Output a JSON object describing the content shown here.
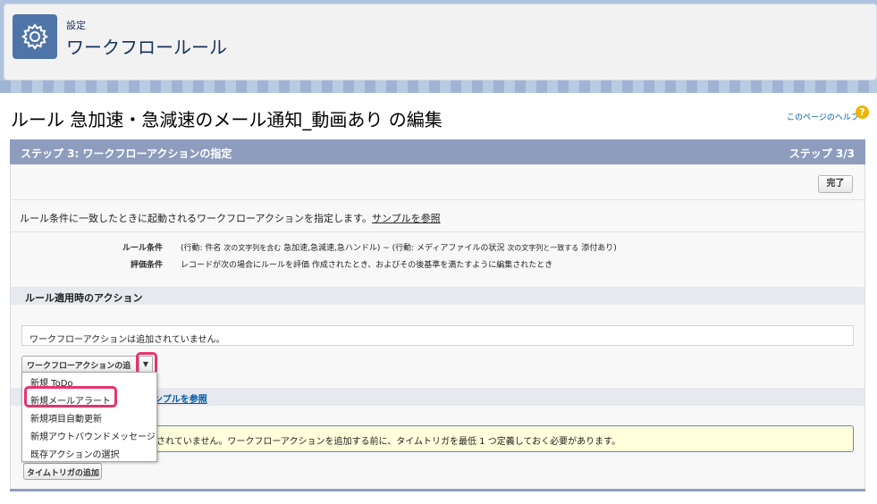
{
  "header": {
    "breadcrumb": "設定",
    "title": "ワークフロールール"
  },
  "page": {
    "edit_title": "ルール 急加速・急減速のメール通知_動画あり の編集",
    "help_link": "このページのヘルプ",
    "help_icon_glyph": "?"
  },
  "step": {
    "label": "ステップ 3: ワークフローアクションの指定",
    "counter": "ステップ 3/3",
    "done_button": "完了"
  },
  "instructions": {
    "text": "ルール条件に一致したときに起動されるワークフローアクションを指定します。",
    "link": "サンプルを参照"
  },
  "rule": {
    "criteria_label": "ルール条件",
    "criteria_value_1": "(行動: 件名",
    "criteria_op_1": "次の文字列を含む",
    "criteria_val_1": "急加速,急減速,急ハンドル) ~ (行動: メディアファイルの状況",
    "criteria_op_2": "次の文字列と一致する",
    "criteria_val_2": "添付あり)",
    "eval_label": "評価条件",
    "eval_value": "レコードが次の場合にルールを評価 作成されたとき、およびその後基準を満たすように編集されたとき"
  },
  "immediate": {
    "header": "ルール適用時のアクション",
    "empty_text": "ワークフローアクションは追加されていません。",
    "add_button": "ワークフローアクションの追加",
    "dropdown_arrow": "▼"
  },
  "menu": {
    "items": [
      "新規 ToDo",
      "新規メールアラート",
      "新規項目自動更新",
      "新規アウトバウンドメッセージ",
      "既存アクションの選択"
    ]
  },
  "time_based": {
    "link": "ンプルを参照",
    "info_text": "されていません。ワークフローアクションを追加する前に、タイムトリガを最低 1 つ定義しておく必要があります。",
    "add_trigger_button": "タイムトリガの追加"
  },
  "colors": {
    "accent": "#4f74a8",
    "step_bar": "#8e9dbe",
    "highlight": "#e8336d"
  }
}
